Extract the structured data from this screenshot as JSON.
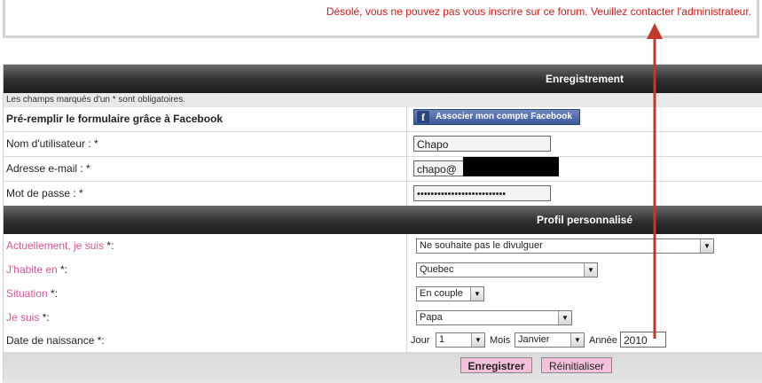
{
  "error": {
    "message": "Désolé, vous ne pouvez pas vous inscrire sur ce forum. Veuillez contacter l'administrateur."
  },
  "register": {
    "header": "Enregistrement",
    "note": "Les champs marqués d'un * sont obligatoires.",
    "facebook_label": "Pré-remplir le formulaire grâce à Facebook",
    "facebook_button": "Associer mon compte Facebook",
    "username_label": "Nom d'utilisateur : *",
    "username_value": "Chapo",
    "email_label": "Adresse e-mail : *",
    "email_value": "chapo@",
    "password_label": "Mot de passe : *",
    "password_value": "••••••••••••••••••••••••••"
  },
  "profile": {
    "header": "Profil personnalisé",
    "currently_label": "Actuellement, je suis",
    "currently_suffix": " *:",
    "currently_value": "Ne souhaite pas le divulguer",
    "live_label": "J'habite en",
    "live_suffix": " *:",
    "live_value": "Quebec",
    "situation_label": "Situation",
    "situation_suffix": " *:",
    "situation_value": "En couple",
    "iam_label": "Je suis",
    "iam_suffix": " *:",
    "iam_value": "Papa",
    "birth_label": "Date de naissance *:",
    "day_label": "Jour",
    "day_value": "1",
    "month_label": "Mois",
    "month_value": "Janvier",
    "year_label": "Année",
    "year_value": "2010"
  },
  "actions": {
    "submit": "Enregistrer",
    "reset": "Réinitialiser"
  },
  "colors": {
    "error": "#d11a1a",
    "pink_label": "#d9579a",
    "button": "#f4c0da",
    "facebook": "#3b5998",
    "annotation_arrow": "#c0392b"
  }
}
